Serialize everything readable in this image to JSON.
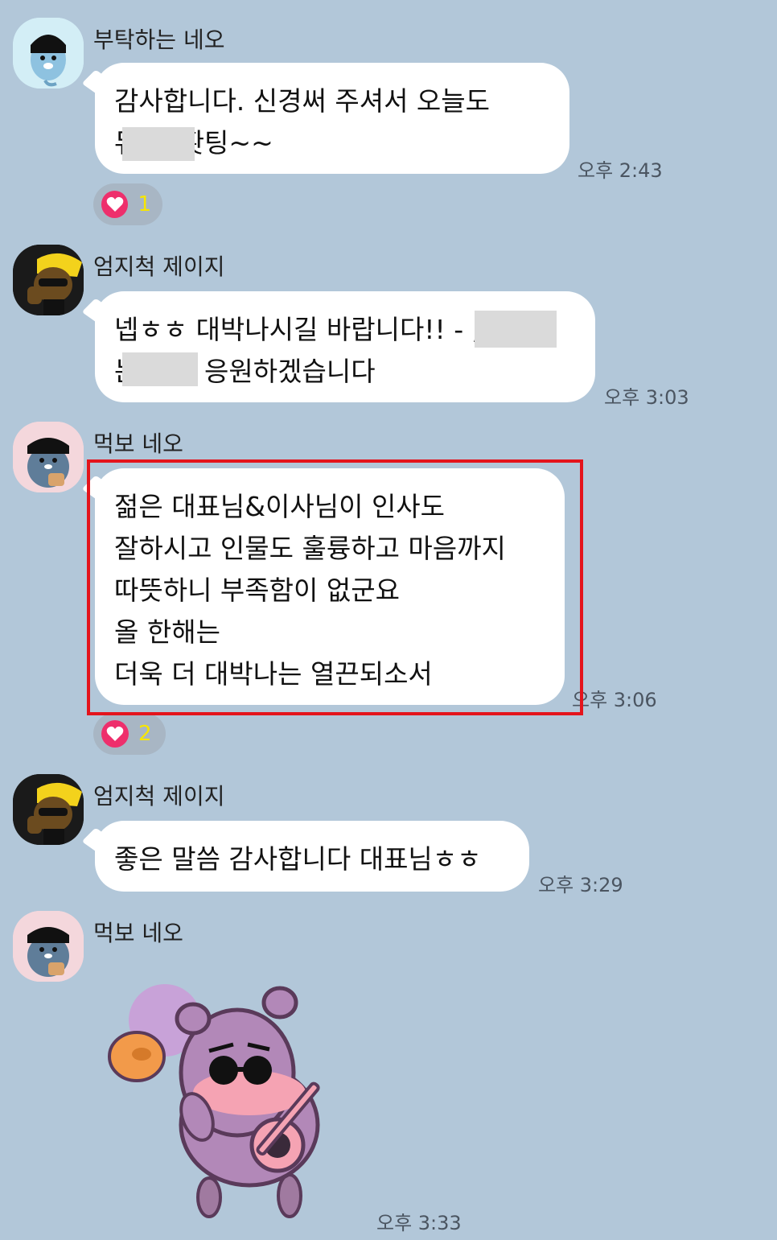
{
  "messages": [
    {
      "sender": "부탁하는 네오",
      "lines": [
        "감사합니다.  신경써 주셔서  오늘도",
        "듀     ㄹ  홧팅~~"
      ],
      "time": "오후 2:43",
      "reaction": {
        "icon": "heart-icon",
        "count": "1"
      }
    },
    {
      "sender": "엄지척 제이지",
      "lines": [
        "넵ㅎㅎ 대박나시길 바랍니다!! ‑             ,",
        "는             모두 응원하겠습니다"
      ],
      "time": "오후 3:03"
    },
    {
      "sender": "먹보 네오",
      "lines": [
        "젊은 대표님&이사님이 인사도",
        "잘하시고 인물도 훌륭하고 마음까지",
        "따뜻하니 부족함이 없군요",
        "올 한해는",
        "더욱 더 대박나는 열끈되소서"
      ],
      "time": "오후 3:06",
      "reaction": {
        "icon": "heart-icon",
        "count": "2"
      }
    },
    {
      "sender": "엄지척 제이지",
      "lines": [
        "좋은 말씀 감사합니다 대표님ㅎㅎ"
      ],
      "time": "오후 3:29"
    },
    {
      "sender": "먹보 네오",
      "sticker": "guitar-sunglasses-bear-sticker",
      "time": "오후 3:33"
    }
  ],
  "colors": {
    "background": "#b2c7d9",
    "bubble": "#ffffff",
    "highlight": "#e4141c",
    "heart": "#ee2f6c",
    "reaction_count": "#f7e600"
  }
}
